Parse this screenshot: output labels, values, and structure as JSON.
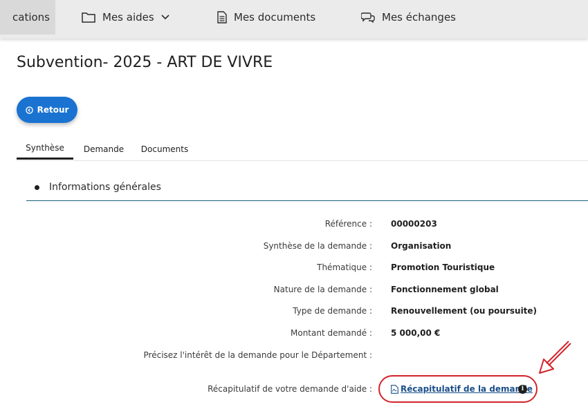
{
  "nav": {
    "items": [
      {
        "label": "cations",
        "icon": "none"
      },
      {
        "label": "Mes aides",
        "icon": "folder-icon"
      },
      {
        "label": "Mes documents",
        "icon": "document-icon"
      },
      {
        "label": "Mes échanges",
        "icon": "chat-icon"
      }
    ]
  },
  "page": {
    "title": "Subvention- 2025 - ART DE VIVRE"
  },
  "back_button": {
    "label": "Retour"
  },
  "tabs": [
    "Synthèse",
    "Demande",
    "Documents"
  ],
  "section": {
    "title": "Informations générales"
  },
  "fields": [
    {
      "label": "Référence :",
      "value": "00000203"
    },
    {
      "label": "Synthèse de la demande :",
      "value": "Organisation"
    },
    {
      "label": "Thématique :",
      "value": "Promotion Touristique"
    },
    {
      "label": "Nature de la demande :",
      "value": "Fonctionnement global"
    },
    {
      "label": "Type de demande :",
      "value": "Renouvellement (ou poursuite)"
    },
    {
      "label": "Montant demandé :",
      "value": "5 000,00 €"
    },
    {
      "label": "Précisez l'intérêt de la demande pour le Département :",
      "value": ""
    },
    {
      "label": "Récapitulatif de votre demande d'aide :",
      "value": "Récapitulatif de la demande"
    }
  ],
  "colors": {
    "accent": "#1a73d1",
    "annotation": "#d3232a",
    "link": "#1a4f8a"
  }
}
